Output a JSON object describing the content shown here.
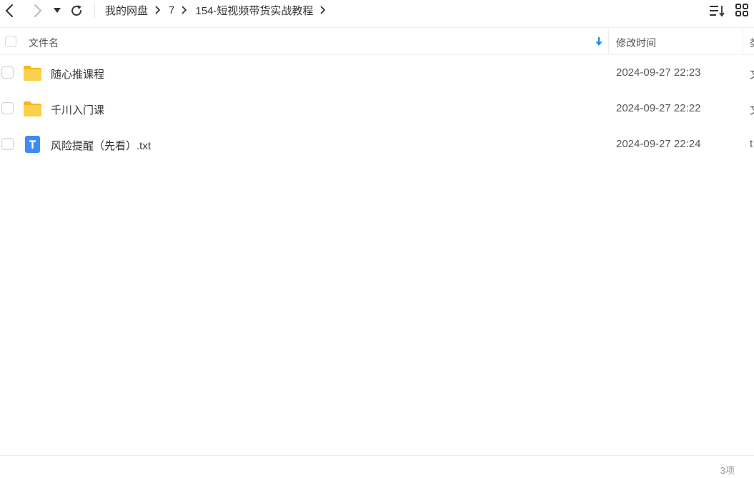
{
  "toolbar": {
    "breadcrumb": [
      "我的网盘",
      "7",
      "154-短视频带货实战教程"
    ]
  },
  "table": {
    "columns": {
      "name": "文件名",
      "modified": "修改时间",
      "type": "类"
    },
    "rows": [
      {
        "name": "随心推课程",
        "modified": "2024-09-27 22:23",
        "type": "文",
        "icon": "folder-icon"
      },
      {
        "name": "千川入门课",
        "modified": "2024-09-27 22:22",
        "type": "文",
        "icon": "folder-icon"
      },
      {
        "name": "风险提醒（先看）.txt",
        "modified": "2024-09-27 22:24",
        "type": "t",
        "icon": "txt-file-icon"
      }
    ]
  },
  "footer": {
    "item_count": "3项"
  },
  "colors": {
    "folder": "#f7c326",
    "txt_icon": "#3b8cf5",
    "sort_arrow": "#1a8cf0"
  }
}
